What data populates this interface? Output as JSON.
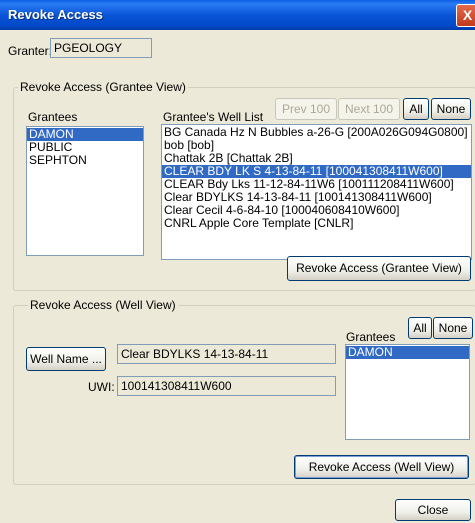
{
  "window": {
    "title": "Revoke Access",
    "close_glyph": "X"
  },
  "granter": {
    "label": "Granter:",
    "value": "PGEOLOGY"
  },
  "grantee_view": {
    "legend": "Revoke Access (Grantee View)",
    "grantees_label": "Grantees",
    "grantees": [
      "DAMON",
      "PUBLIC",
      "SEPHTON"
    ],
    "selected_grantee": "DAMON",
    "well_list_label": "Grantee's Well List",
    "prev_label": "Prev 100",
    "next_label": "Next 100",
    "all_label": "All",
    "none_label": "None",
    "wells": [
      "BG Canada Hz N Bubbles a-26-G  [200A026G094G0800]",
      "bob  [bob]",
      "Chattak 2B  [Chattak 2B]",
      "CLEAR BDY LK S 4-13-84-11  [100041308411W600]",
      "CLEAR Bdy Lks 11-12-84-11W6  [100111208411W600]",
      "Clear BDYLKS 14-13-84-11  [100141308411W600]",
      "Clear Cecil 4-6-84-10  [100040608410W600]",
      "CNRL Apple Core Template  [CNLR]"
    ],
    "selected_well_index": 3,
    "revoke_label": "Revoke Access (Grantee View)"
  },
  "well_view": {
    "legend": "Revoke Access (Well View)",
    "well_name_button": "Well Name ...",
    "well_name_value": "Clear BDYLKS 14-13-84-11",
    "uwi_label": "UWI:",
    "uwi_value": "100141308411W600",
    "grantees_label": "Grantees",
    "all_label": "All",
    "none_label": "None",
    "grantees": [
      "DAMON"
    ],
    "revoke_label": "Revoke Access (Well View)"
  },
  "close_label": "Close"
}
